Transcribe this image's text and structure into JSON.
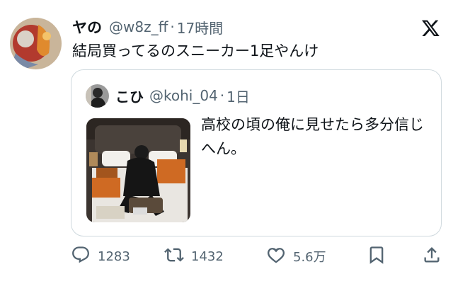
{
  "tweet": {
    "author_name": "ヤの",
    "author_handle": "@w8z_ff",
    "separator": "·",
    "time": "17時間",
    "text": "結局買ってるのスニーカー1足やんけ"
  },
  "quote": {
    "author_name": "こひ",
    "author_handle": "@kohi_04",
    "separator": "·",
    "time": "1日",
    "text": "高校の頃の俺に見せたら多分信じへん。"
  },
  "actions": {
    "reply_count": "1283",
    "retweet_count": "1432",
    "like_count": "5.6万"
  },
  "icons": {
    "platform": "x-logo-icon",
    "reply": "reply-icon",
    "retweet": "retweet-icon",
    "like": "heart-icon",
    "bookmark": "bookmark-icon",
    "share": "share-icon"
  },
  "colors": {
    "text_primary": "#0f1419",
    "text_secondary": "#536471",
    "border": "#cfd9de"
  }
}
